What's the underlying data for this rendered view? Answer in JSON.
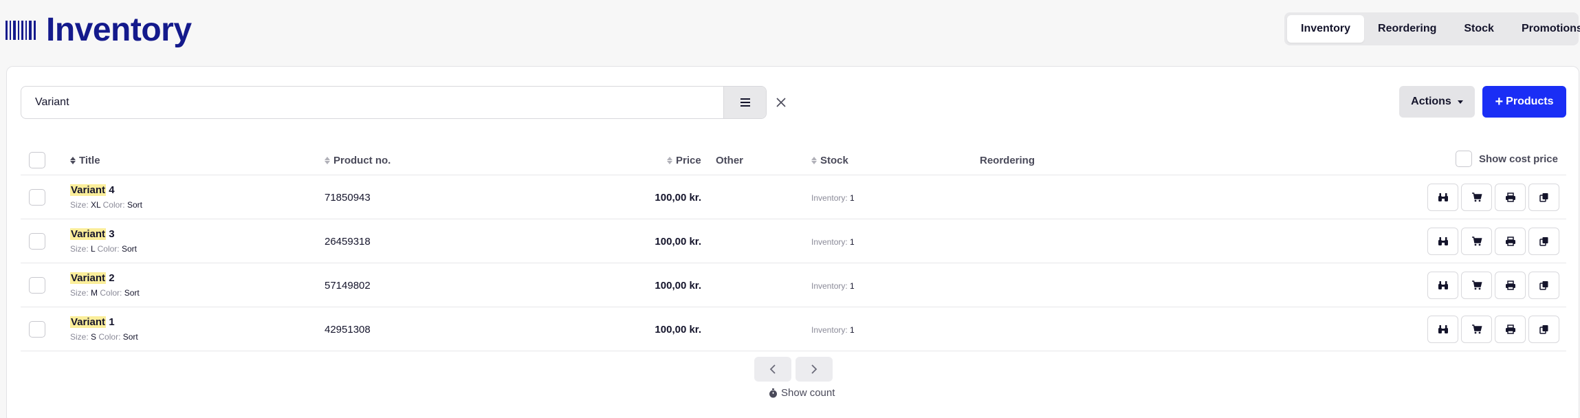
{
  "app": {
    "title": "Inventory"
  },
  "tabs": [
    {
      "label": "Inventory",
      "active": true
    },
    {
      "label": "Reordering",
      "active": false
    },
    {
      "label": "Stock",
      "active": false
    },
    {
      "label": "Promotions",
      "active": false
    }
  ],
  "search": {
    "value": "Variant",
    "placeholder": ""
  },
  "toolbar": {
    "actions_label": "Actions",
    "products_label": "Products"
  },
  "table": {
    "headers": {
      "title": "Title",
      "product_no": "Product no.",
      "price": "Price",
      "other": "Other",
      "stock": "Stock",
      "reordering": "Reordering",
      "show_cost_price": "Show cost price"
    },
    "rows": [
      {
        "title_highlight": "Variant",
        "title_rest": " 4",
        "size_label": "Size:",
        "size": "XL",
        "color_label": "Color:",
        "color": "Sort",
        "product_no": "71850943",
        "price": "100,00 kr.",
        "stock_label": "Inventory:",
        "stock": "1"
      },
      {
        "title_highlight": "Variant",
        "title_rest": " 3",
        "size_label": "Size:",
        "size": "L",
        "color_label": "Color:",
        "color": "Sort",
        "product_no": "26459318",
        "price": "100,00 kr.",
        "stock_label": "Inventory:",
        "stock": "1"
      },
      {
        "title_highlight": "Variant",
        "title_rest": " 2",
        "size_label": "Size:",
        "size": "M",
        "color_label": "Color:",
        "color": "Sort",
        "product_no": "57149802",
        "price": "100,00 kr.",
        "stock_label": "Inventory:",
        "stock": "1"
      },
      {
        "title_highlight": "Variant",
        "title_rest": " 1",
        "size_label": "Size:",
        "size": "S",
        "color_label": "Color:",
        "color": "Sort",
        "product_no": "42951308",
        "price": "100,00 kr.",
        "stock_label": "Inventory:",
        "stock": "1"
      }
    ],
    "row_icons": [
      "binoculars-icon",
      "cart-icon",
      "printer-icon",
      "copy-icon"
    ]
  },
  "pagination": {
    "show_count_label": "Show count"
  },
  "colors": {
    "brand": "#141a8c",
    "primary_button": "#1a2ef5",
    "highlight": "#fbee9a"
  }
}
